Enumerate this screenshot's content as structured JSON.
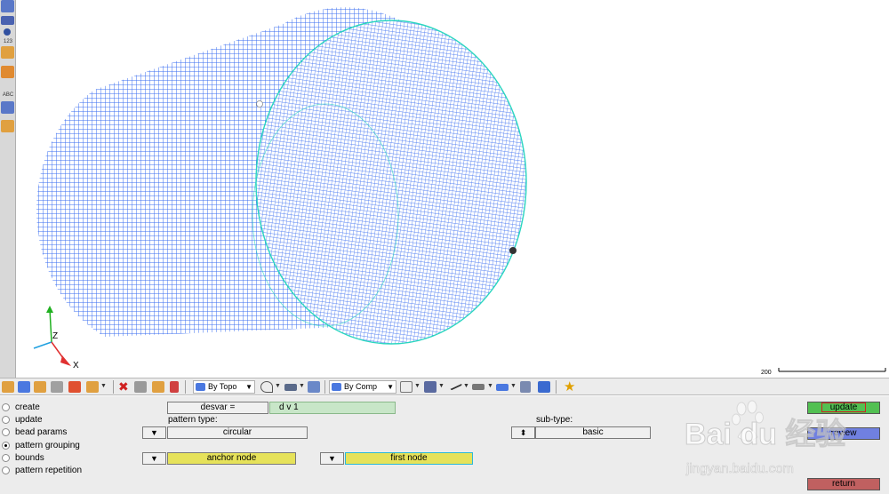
{
  "left_toolbar": {
    "labels": [
      "123",
      "ABC"
    ]
  },
  "viewport": {
    "axis": {
      "z_label": "Z",
      "x_label": "X"
    },
    "scale_label": "200",
    "mesh_color": "#3a6ef0",
    "edge_color": "#2bd6c0"
  },
  "toolbar": {
    "topo_select": "By Topo",
    "comp_select": "By Comp"
  },
  "panel": {
    "radios": [
      {
        "label": "create",
        "selected": false
      },
      {
        "label": "update",
        "selected": false
      },
      {
        "label": "bead params",
        "selected": false
      },
      {
        "label": "pattern grouping",
        "selected": true
      },
      {
        "label": "bounds",
        "selected": false
      },
      {
        "label": "pattern repetition",
        "selected": false
      }
    ],
    "desvar_label": "desvar =",
    "desvar_value": "d v 1",
    "pattern_type_label": "pattern type:",
    "pattern_type_value": "circular",
    "subtype_label": "sub-type:",
    "subtype_value": "basic",
    "anchor_node": "anchor node",
    "first_node": "first node",
    "update_label": "update",
    "review_label": "review",
    "return_label": "return"
  },
  "watermark": {
    "brand": "Bai du 经验",
    "url": "jingyan.baidu.com"
  },
  "colors": {
    "update": "#52c052",
    "review": "#7080e0",
    "return": "#c06060",
    "yellow_button": "#e6e25a",
    "desvar_field": "#c8e6c8"
  }
}
